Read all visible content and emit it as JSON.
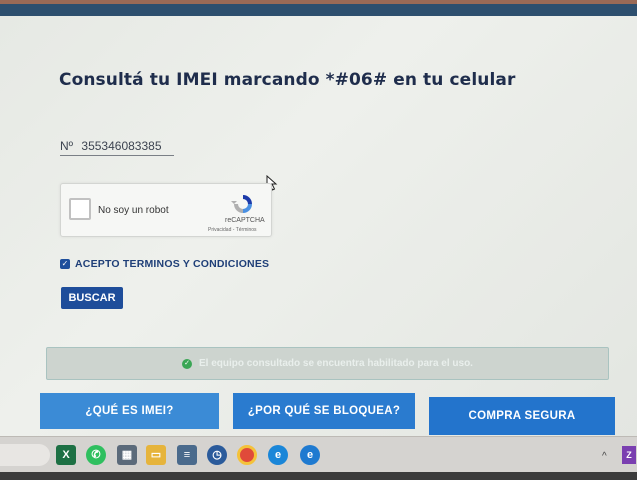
{
  "page": {
    "title": "Consultá tu IMEI marcando *#06# en tu celular"
  },
  "imei": {
    "prefix": "Nº",
    "value": "355346083385"
  },
  "captcha": {
    "label": "No soy un robot",
    "brand": "reCAPTCHA",
    "links": "Privacidad - Términos",
    "checked": false
  },
  "terms": {
    "label": "ACEPTO TERMINOS Y CONDICIONES",
    "checked": true
  },
  "buttons": {
    "search": "BUSCAR"
  },
  "status": {
    "message": "El equipo consultado se encuentra habilitado para el uso.",
    "icon": "check-circle-icon"
  },
  "nav": [
    {
      "label": "¿QUÉ ES IMEI?"
    },
    {
      "label": "¿POR QUÉ SE BLOQUEA?"
    },
    {
      "label": "COMPRA SEGURA"
    }
  ],
  "taskbar": {
    "apps": [
      "excel-icon",
      "whatsapp-icon",
      "calculator-icon",
      "folder-icon",
      "notepad-icon",
      "clock-icon",
      "chrome-icon",
      "edge-icon",
      "edge-icon-2"
    ],
    "tray_chevron": "^",
    "tray_app_label": "Z"
  },
  "colors": {
    "title": "#1f2d4c",
    "primary_button": "#1e4d9a",
    "nav_button": "#2d7fd0",
    "status_bg": "#cdd4cf",
    "success": "#3aa655"
  }
}
